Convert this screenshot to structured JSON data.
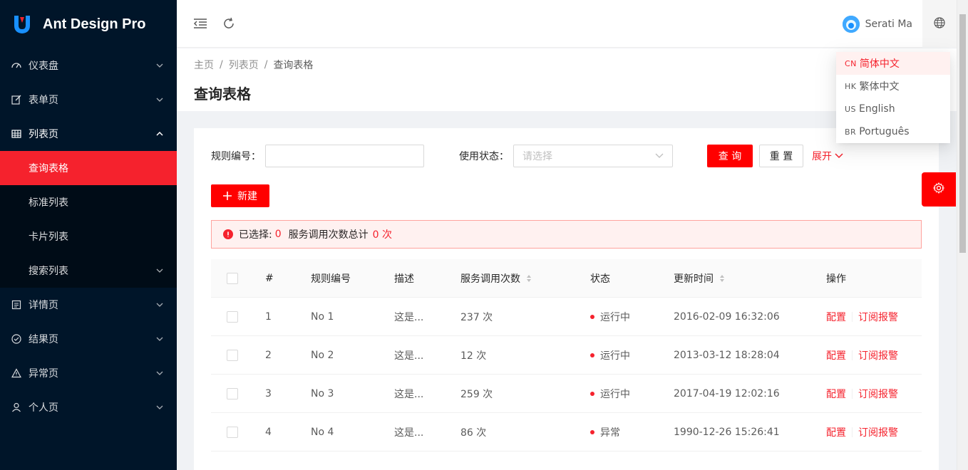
{
  "app": {
    "title": "Ant Design Pro"
  },
  "colors": {
    "primary": "#ff0000",
    "sider_bg": "#001529",
    "link": "#f5222d"
  },
  "sidebar": {
    "items": [
      {
        "label": "仪表盘",
        "icon": "dashboard-icon",
        "expanded": false
      },
      {
        "label": "表单页",
        "icon": "form-icon",
        "expanded": false
      },
      {
        "label": "列表页",
        "icon": "table-icon",
        "expanded": true,
        "children": [
          {
            "label": "查询表格",
            "active": true
          },
          {
            "label": "标准列表"
          },
          {
            "label": "卡片列表"
          },
          {
            "label": "搜索列表",
            "has_children": true
          }
        ]
      },
      {
        "label": "详情页",
        "icon": "profile-icon",
        "expanded": false
      },
      {
        "label": "结果页",
        "icon": "check-circle-icon",
        "expanded": false
      },
      {
        "label": "异常页",
        "icon": "warning-icon",
        "expanded": false
      },
      {
        "label": "个人页",
        "icon": "user-icon",
        "expanded": false
      }
    ]
  },
  "header": {
    "user_name": "Serati Ma"
  },
  "breadcrumb": [
    "主页",
    "列表页",
    "查询表格"
  ],
  "page": {
    "title": "查询表格"
  },
  "search_form": {
    "rule_label": "规则编号：",
    "rule_value": "",
    "status_label": "使用状态：",
    "status_placeholder": "请选择",
    "query_label": "查 询",
    "reset_label": "重 置",
    "expand_label": "展开"
  },
  "toolbar": {
    "new_label": "新建"
  },
  "alert": {
    "selected_prefix": "已选择:",
    "selected_count": "0",
    "total_prefix": "服务调用次数总计",
    "total_value": "0 次"
  },
  "table": {
    "columns": [
      "#",
      "规则编号",
      "描述",
      "服务调用次数",
      "状态",
      "更新时间",
      "操作"
    ],
    "rows": [
      {
        "no": "1",
        "rule": "No 1",
        "desc": "这是...",
        "calls": "237 次",
        "status": "运行中",
        "time": "2016-02-09 16:32:06"
      },
      {
        "no": "2",
        "rule": "No 2",
        "desc": "这是...",
        "calls": "12 次",
        "status": "运行中",
        "time": "2013-03-12 18:28:04"
      },
      {
        "no": "3",
        "rule": "No 3",
        "desc": "这是...",
        "calls": "259 次",
        "status": "运行中",
        "time": "2017-04-19 12:02:16"
      },
      {
        "no": "4",
        "rule": "No 4",
        "desc": "这是...",
        "calls": "86 次",
        "status": "异常",
        "time": "1990-12-26 15:26:41"
      }
    ],
    "op_config": "配置",
    "op_subscribe": "订阅报警"
  },
  "language_menu": {
    "items": [
      {
        "code": "CN",
        "label": "简体中文",
        "active": true
      },
      {
        "code": "HK",
        "label": "繁体中文"
      },
      {
        "code": "US",
        "label": "English"
      },
      {
        "code": "BR",
        "label": "Português"
      }
    ]
  }
}
